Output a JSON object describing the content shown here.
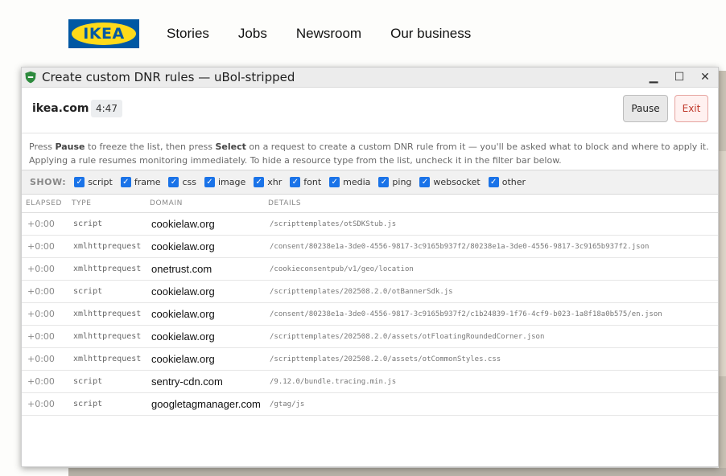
{
  "site": {
    "logo_text": "IKEA",
    "nav": [
      "Stories",
      "Jobs",
      "Newsroom",
      "Our business"
    ]
  },
  "window": {
    "title": "Create custom DNR rules — uBol-stripped",
    "controls": {
      "minimize": "▁",
      "maximize": "☐",
      "close": "✕"
    }
  },
  "toolbar": {
    "site_name": "ikea.com",
    "timer": "4:47",
    "pause_label": "Pause",
    "exit_label": "Exit"
  },
  "help": {
    "t1": "Press ",
    "b1": "Pause",
    "t2": " to freeze the list, then press ",
    "b2": "Select",
    "t3": " on a request to create a custom DNR rule from it — you'll be asked what to block and where to apply it. Applying a rule resumes monitoring immediately. To hide a resource type from the list, uncheck it in the filter bar below."
  },
  "filters": {
    "label": "SHOW:",
    "items": [
      {
        "label": "script",
        "checked": true
      },
      {
        "label": "frame",
        "checked": true
      },
      {
        "label": "css",
        "checked": true
      },
      {
        "label": "image",
        "checked": true
      },
      {
        "label": "xhr",
        "checked": true
      },
      {
        "label": "font",
        "checked": true
      },
      {
        "label": "media",
        "checked": true
      },
      {
        "label": "ping",
        "checked": true
      },
      {
        "label": "websocket",
        "checked": true
      },
      {
        "label": "other",
        "checked": true
      }
    ]
  },
  "table": {
    "columns": [
      "ELAPSED",
      "TYPE",
      "DOMAIN",
      "DETAILS"
    ],
    "rows": [
      {
        "elapsed": "+0:00",
        "type": "script",
        "domain": "cookielaw.org",
        "details": "/scripttemplates/otSDKStub.js"
      },
      {
        "elapsed": "+0:00",
        "type": "xmlhttprequest",
        "domain": "cookielaw.org",
        "details": "/consent/80238e1a-3de0-4556-9817-3c9165b937f2/80238e1a-3de0-4556-9817-3c9165b937f2.json"
      },
      {
        "elapsed": "+0:00",
        "type": "xmlhttprequest",
        "domain": "onetrust.com",
        "details": "/cookieconsentpub/v1/geo/location"
      },
      {
        "elapsed": "+0:00",
        "type": "script",
        "domain": "cookielaw.org",
        "details": "/scripttemplates/202508.2.0/otBannerSdk.js"
      },
      {
        "elapsed": "+0:00",
        "type": "xmlhttprequest",
        "domain": "cookielaw.org",
        "details": "/consent/80238e1a-3de0-4556-9817-3c9165b937f2/c1b24839-1f76-4cf9-b023-1a8f18a0b575/en.json"
      },
      {
        "elapsed": "+0:00",
        "type": "xmlhttprequest",
        "domain": "cookielaw.org",
        "details": "/scripttemplates/202508.2.0/assets/otFloatingRoundedCorner.json"
      },
      {
        "elapsed": "+0:00",
        "type": "xmlhttprequest",
        "domain": "cookielaw.org",
        "details": "/scripttemplates/202508.2.0/assets/otCommonStyles.css"
      },
      {
        "elapsed": "+0:00",
        "type": "script",
        "domain": "sentry-cdn.com",
        "details": "/9.12.0/bundle.tracing.min.js"
      },
      {
        "elapsed": "+0:00",
        "type": "script",
        "domain": "googletagmanager.com",
        "details": "/gtag/js"
      }
    ]
  }
}
